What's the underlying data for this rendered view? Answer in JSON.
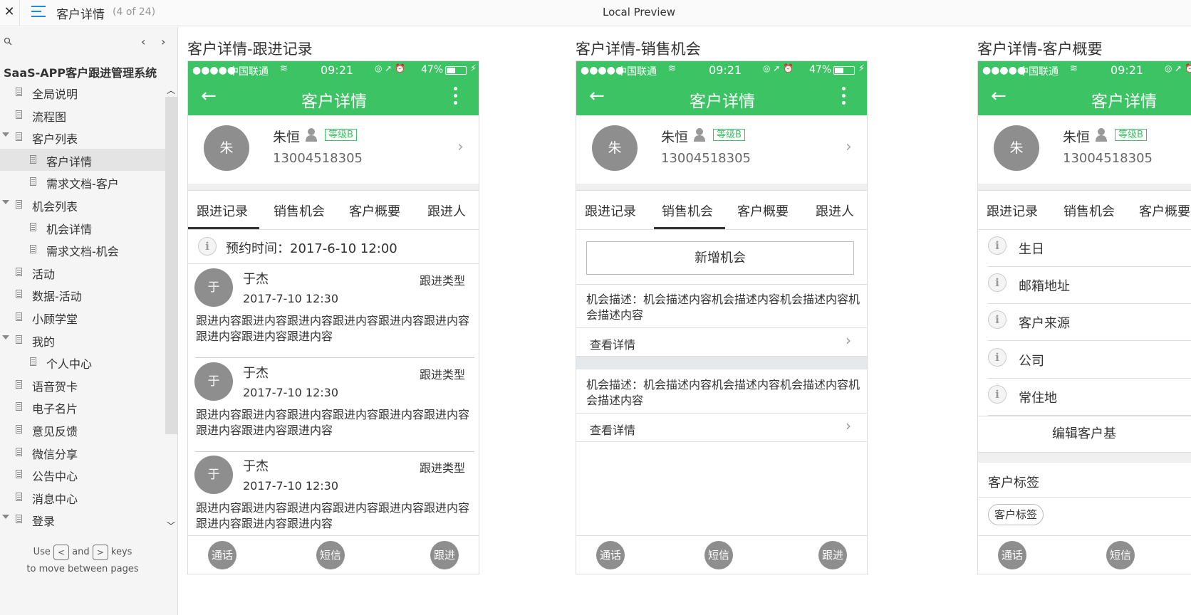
{
  "topbar": {
    "close_glyph": "✕",
    "menu_icon": "hamburger-menu-icon",
    "page_title": "客户详情",
    "page_count": "(4 of 24)",
    "preview_label": "Local Preview"
  },
  "sidebar": {
    "project_name": "SaaS-APP客户跟进管理系统",
    "prev_glyph": "‹",
    "next_glyph": "›",
    "items": [
      {
        "label": "全局说明",
        "level": 0,
        "expand": false,
        "active": false
      },
      {
        "label": "流程图",
        "level": 0,
        "expand": false,
        "active": false
      },
      {
        "label": "客户列表",
        "level": 0,
        "expand": true,
        "active": false
      },
      {
        "label": "客户详情",
        "level": 1,
        "expand": false,
        "active": true
      },
      {
        "label": "需求文档-客户",
        "level": 1,
        "expand": false,
        "active": false
      },
      {
        "label": "机会列表",
        "level": 0,
        "expand": true,
        "active": false
      },
      {
        "label": "机会详情",
        "level": 1,
        "expand": false,
        "active": false
      },
      {
        "label": "需求文档-机会",
        "level": 1,
        "expand": false,
        "active": false
      },
      {
        "label": "活动",
        "level": 0,
        "expand": false,
        "active": false
      },
      {
        "label": "数据-活动",
        "level": 0,
        "expand": false,
        "active": false
      },
      {
        "label": "小顾学堂",
        "level": 0,
        "expand": false,
        "active": false
      },
      {
        "label": "我的",
        "level": 0,
        "expand": true,
        "active": false
      },
      {
        "label": "个人中心",
        "level": 1,
        "expand": false,
        "active": false
      },
      {
        "label": "语音贺卡",
        "level": 0,
        "expand": false,
        "active": false
      },
      {
        "label": "电子名片",
        "level": 0,
        "expand": false,
        "active": false
      },
      {
        "label": "意见反馈",
        "level": 0,
        "expand": false,
        "active": false
      },
      {
        "label": "微信分享",
        "level": 0,
        "expand": false,
        "active": false
      },
      {
        "label": "公告中心",
        "level": 0,
        "expand": false,
        "active": false
      },
      {
        "label": "消息中心",
        "level": 0,
        "expand": false,
        "active": false
      },
      {
        "label": "登录",
        "level": 0,
        "expand": true,
        "active": false
      }
    ],
    "hint": {
      "use": "Use",
      "key_left": "<",
      "and": "and",
      "key_right": ">",
      "keys": "keys",
      "line2": "to move between pages"
    }
  },
  "phone_common": {
    "signal": "●●●●●",
    "carrier": "中国联通",
    "wifi_glyph": "≋",
    "time": "09:21",
    "sys_icons": "◎ ➚ ⏰",
    "battery_pct": "47%",
    "battery_fill": 0.47,
    "bolt": "⚡",
    "back_glyph": "←",
    "nav_title": "客户详情",
    "customer": {
      "avatar_char": "朱",
      "name": "朱恒",
      "level": "等级B",
      "phone": "13004518305"
    },
    "tabs": [
      "跟进记录",
      "销售机会",
      "客户概要",
      "跟进人"
    ],
    "actions": [
      "通话",
      "短信",
      "跟进"
    ]
  },
  "mock1": {
    "title": "客户详情-跟进记录",
    "appointment": "预约时间：2017-6-10 12:00",
    "records": [
      {
        "avatar": "于",
        "name": "于杰",
        "type": "跟进类型",
        "time": "2017-7-10 12:30",
        "content": "跟进内容跟进内容跟进内容跟进内容跟进内容跟进内容跟进内容跟进内容跟进内容"
      },
      {
        "avatar": "于",
        "name": "于杰",
        "type": "跟进类型",
        "time": "2017-7-10 12:30",
        "content": "跟进内容跟进内容跟进内容跟进内容跟进内容跟进内容跟进内容跟进内容跟进内容"
      },
      {
        "avatar": "于",
        "name": "于杰",
        "type": "跟进类型",
        "time": "2017-7-10 12:30",
        "content": "跟进内容跟进内容跟进内容跟进内容跟进内容跟进内容跟进内容跟进内容跟进内容"
      }
    ]
  },
  "mock2": {
    "title": "客户详情-销售机会",
    "add_button": "新增机会",
    "opportunities": [
      {
        "desc": "机会描述：机会描述内容机会描述内容机会描述内容机会描述内容",
        "link": "查看详情"
      },
      {
        "desc": "机会描述：机会描述内容机会描述内容机会描述内容机会描述内容",
        "link": "查看详情"
      }
    ]
  },
  "mock3": {
    "title": "客户详情-客户概要",
    "fields": [
      "生日",
      "邮箱地址",
      "客户来源",
      "公司",
      "常住地"
    ],
    "edit_button": "编辑客户基",
    "tag_title": "客户标签",
    "tag_chip": "客户标签"
  },
  "colors": {
    "brand_green": "#3cc464",
    "avatar_gray": "#8e8e8e",
    "accent_blue": "#1e88e5"
  }
}
